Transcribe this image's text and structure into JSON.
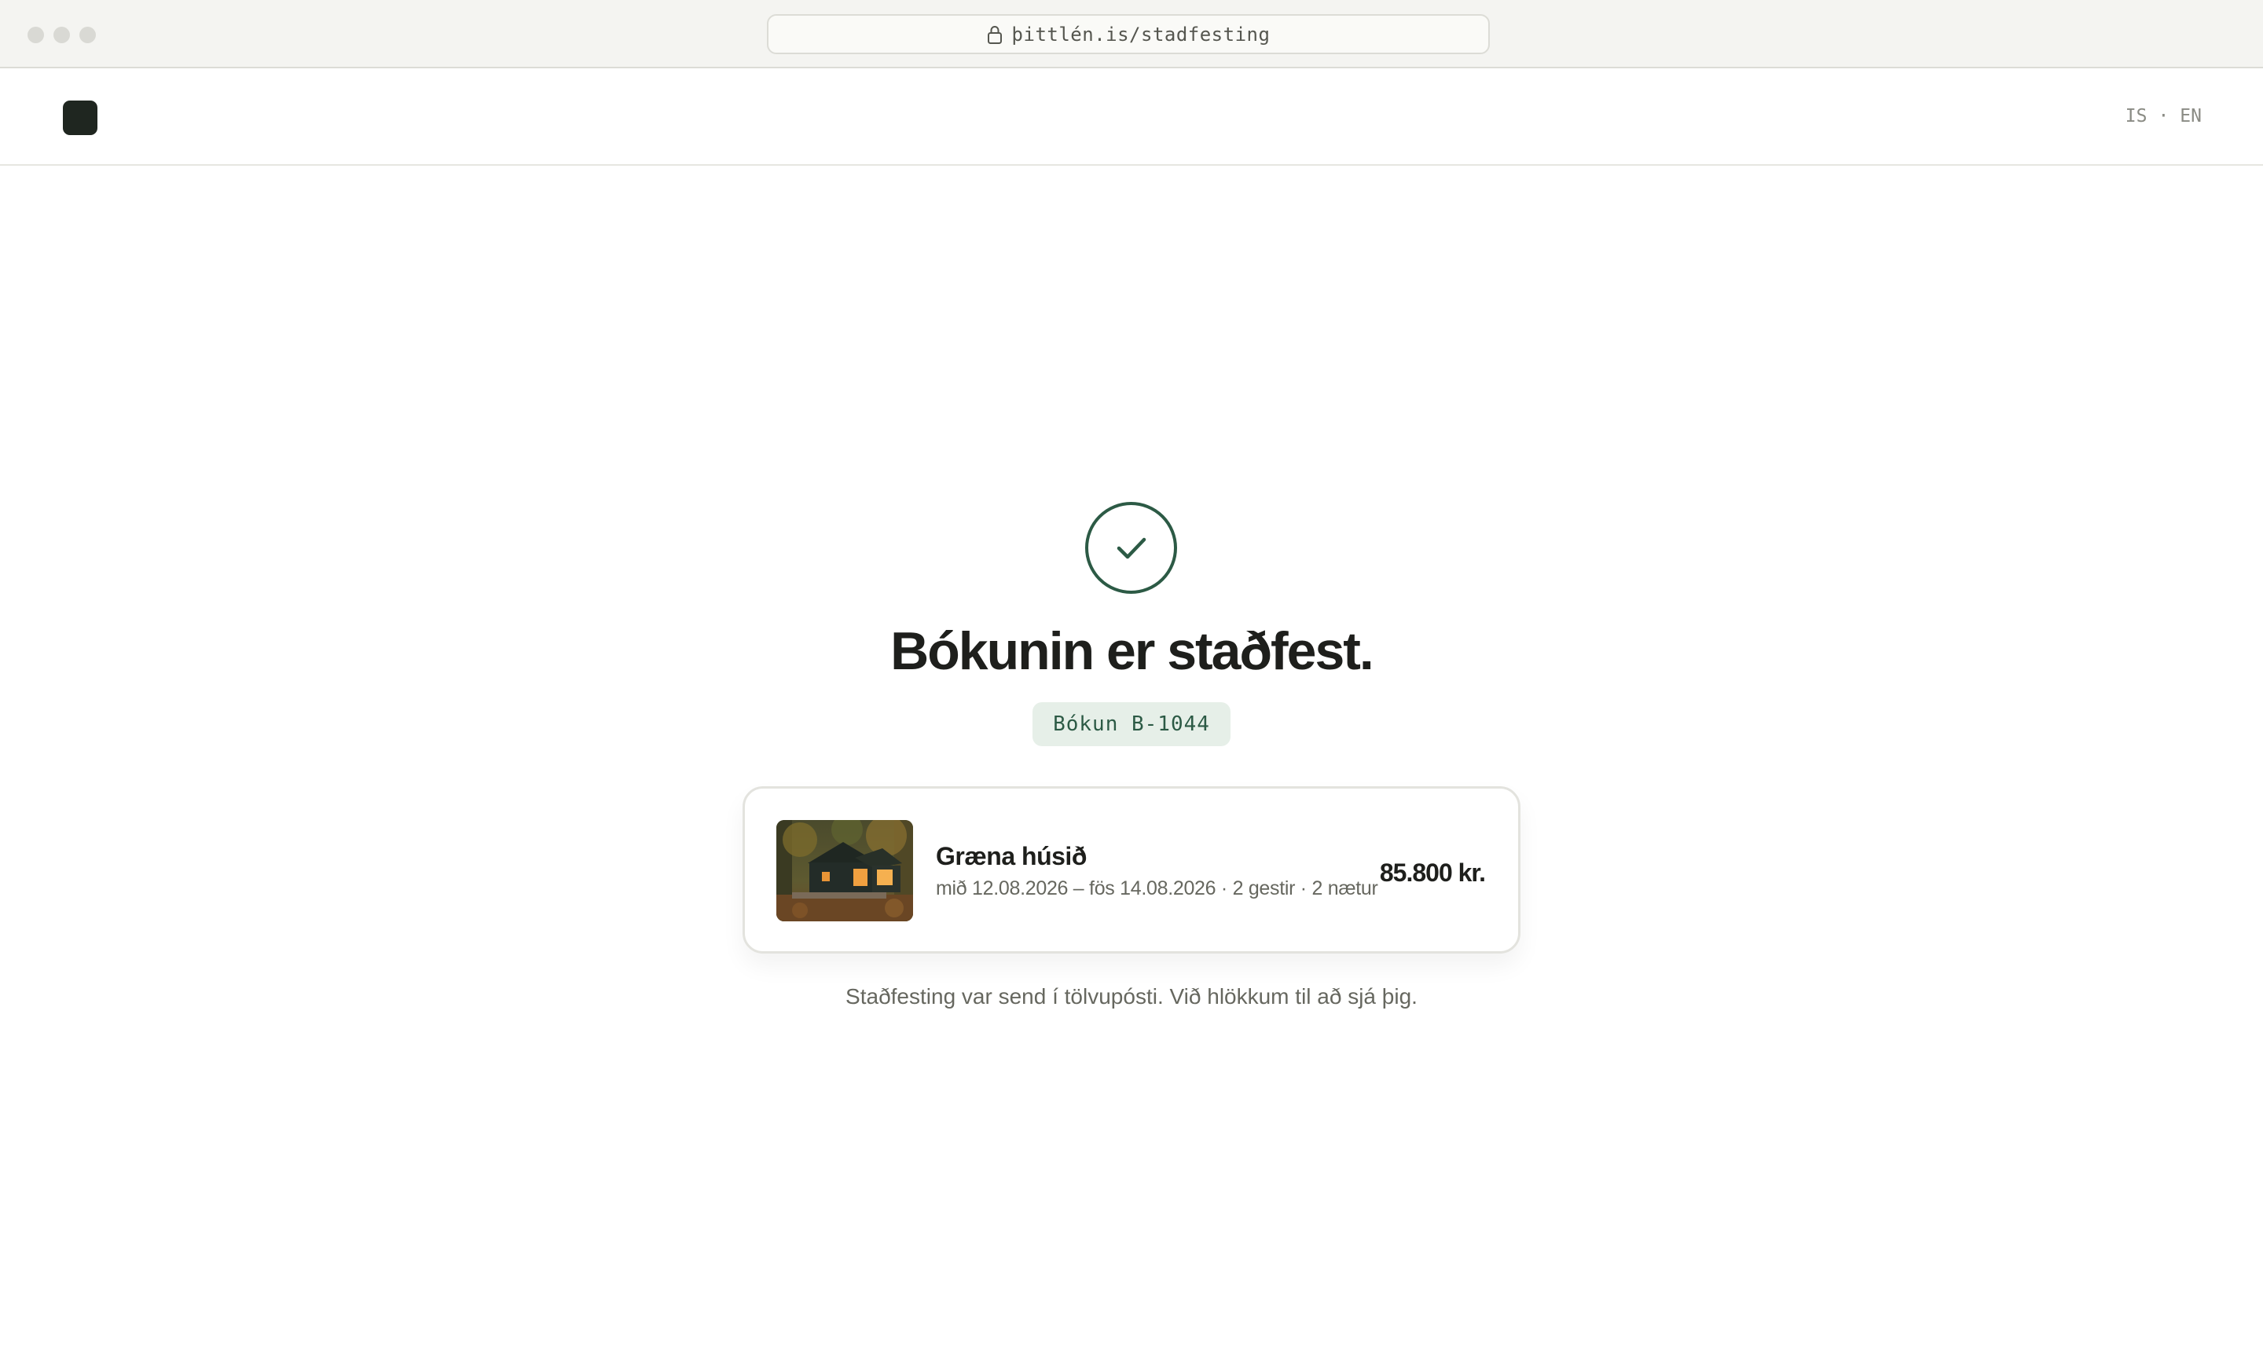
{
  "browser": {
    "url": "þittlén.is/stadfesting"
  },
  "header": {
    "lang_is": "IS",
    "lang_separator": "·",
    "lang_en": "EN"
  },
  "confirmation": {
    "title": "Bókunin er staðfest.",
    "booking_ref": "Bókun B-1044"
  },
  "booking_card": {
    "name": "Græna húsið",
    "details": "mið 12.08.2026 – fös 14.08.2026 · 2 gestir · 2 nætur",
    "price": "85.800 kr."
  },
  "footnote": "Staðfesting var send í tölvupósti. Við hlökkum til að sjá þig.",
  "colors": {
    "accent": "#2c5a45",
    "badge_bg": "#e6efe8",
    "logo": "#1f2620"
  }
}
